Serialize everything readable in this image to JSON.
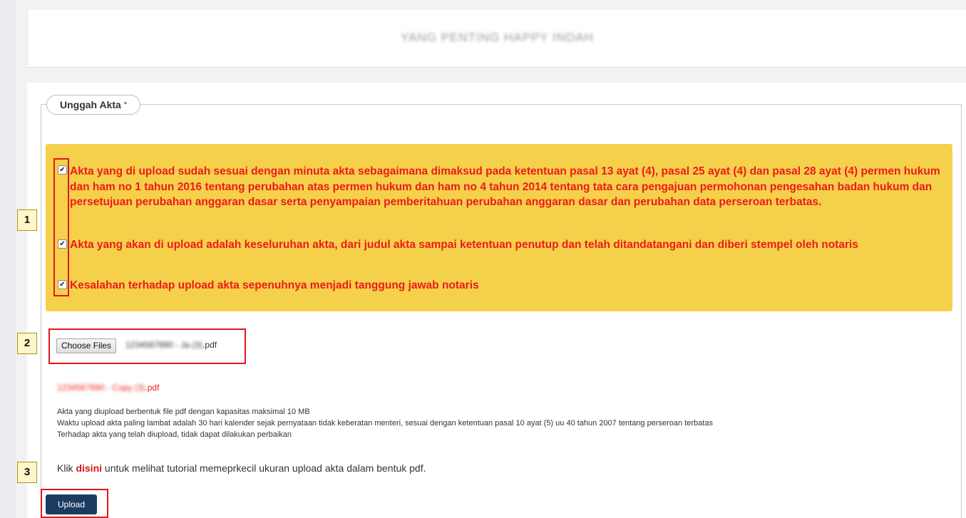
{
  "header": {
    "title": "YANG PENTING HAPPY INDAH"
  },
  "section": {
    "legend": "Unggah Akta",
    "required_mark": "*"
  },
  "agreements": [
    {
      "checked": true,
      "text": "Akta yang di upload sudah sesuai dengan minuta akta sebagaimana dimaksud pada ketentuan pasal 13 ayat (4), pasal 25 ayat (4) dan pasal 28 ayat (4) permen hukum dan ham no 1 tahun 2016 tentang perubahan atas permen hukum dan ham no 4 tahun 2014 tentang tata cara pengajuan permohonan pengesahan badan hukum dan persetujuan perubahan anggaran dasar serta penyampaian pemberitahuan perubahan anggaran dasar dan perubahan data perseroan terbatas."
    },
    {
      "checked": true,
      "text": "Akta yang akan di upload adalah keseluruhan akta, dari judul akta sampai ketentuan penutup dan telah ditandatangani dan diberi stempel oleh notaris"
    },
    {
      "checked": true,
      "text": "Kesalahan terhadap upload akta sepenuhnya menjadi tanggung jawab notaris"
    }
  ],
  "steps": [
    "1",
    "2",
    "3"
  ],
  "file_input": {
    "button_label": "Choose Files",
    "file_name_blurred": "1234567890 - Ja (3)",
    "file_ext": ".pdf"
  },
  "uploaded_file": {
    "name_blurred": "1234567890 - Copy (3)",
    "ext": ".pdf"
  },
  "notes": [
    "Akta yang diupload berbentuk file pdf dengan kapasitas maksimal 10 MB",
    "Waktu upload akta paling lambat adalah 30 hari kalender sejak pernyataan tidak keberatan menteri, sesuai dengan ketentuan pasal 10 ayat (5) uu 40 tahun 2007 tentang perseroan terbatas",
    "Terhadap akta yang telah diupload, tidak dapat dilakukan perbaikan"
  ],
  "tutorial": {
    "prefix": "Klik",
    "link_label": "disini",
    "suffix": "untuk melihat tutorial memeprkecil ukuran upload akta dalam bentuk pdf."
  },
  "upload_button": {
    "label": "Upload"
  },
  "colors": {
    "highlight": "#f5d04b",
    "warning_text": "#ee1a1a",
    "primary_button": "#1d3b5f",
    "annotation_frame": "#e01818"
  }
}
